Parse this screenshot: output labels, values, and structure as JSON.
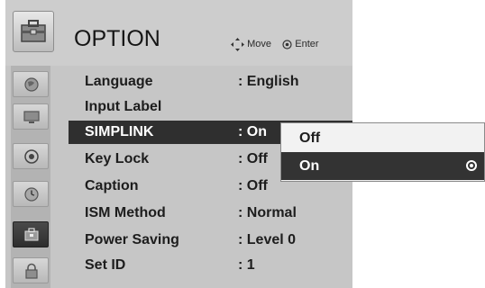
{
  "header": {
    "title": "OPTION",
    "hint_move": "Move",
    "hint_enter": "Enter"
  },
  "sidebar": {
    "tabs": [
      {
        "icon": "globe-icon"
      },
      {
        "icon": "monitor-icon"
      },
      {
        "icon": "speaker-icon"
      },
      {
        "icon": "clock-icon"
      },
      {
        "icon": "option-toolbox-icon"
      },
      {
        "icon": "lock-icon"
      }
    ],
    "active_index": 4
  },
  "menu": {
    "items": [
      {
        "label": "Language",
        "value": ": English"
      },
      {
        "label": "Input Label",
        "value": ""
      },
      {
        "label": "SIMPLINK",
        "value": ": On"
      },
      {
        "label": "Key Lock",
        "value": ": Off"
      },
      {
        "label": "Caption",
        "value": ": Off"
      },
      {
        "label": "ISM Method",
        "value": ": Normal"
      },
      {
        "label": "Power Saving",
        "value": ": Level 0"
      },
      {
        "label": "Set ID",
        "value": ": 1"
      }
    ],
    "selected_index": 2
  },
  "popup": {
    "options": [
      {
        "label": "Off"
      },
      {
        "label": "On"
      }
    ],
    "selected_index": 1
  }
}
